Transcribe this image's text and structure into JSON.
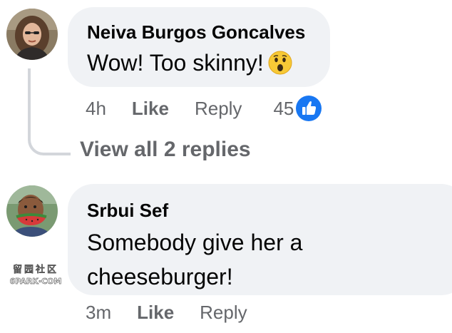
{
  "comments": [
    {
      "author": "Neiva Burgos Goncalves",
      "text": "Wow! Too skinny!",
      "emoji": "astonished-face-emoji",
      "time": "4h",
      "like_label": "Like",
      "reply_label": "Reply",
      "reaction_count": "45",
      "reaction_icon": "thumbs-up-icon",
      "view_replies_label": "View all 2 replies"
    },
    {
      "author": "Srbui Sef",
      "text_lines": [
        "Somebody give her a",
        "cheeseburger!"
      ],
      "time": "3m",
      "like_label": "Like",
      "reply_label": "Reply"
    }
  ],
  "watermark": {
    "line1": "留园社区",
    "line2": "6PARK·COM"
  },
  "colors": {
    "bubble": "#f0f2f5",
    "secondary_text": "#65676b",
    "primary_text": "#050505",
    "like_blue": "#1877f2",
    "thread_line": "#d3d6db"
  }
}
